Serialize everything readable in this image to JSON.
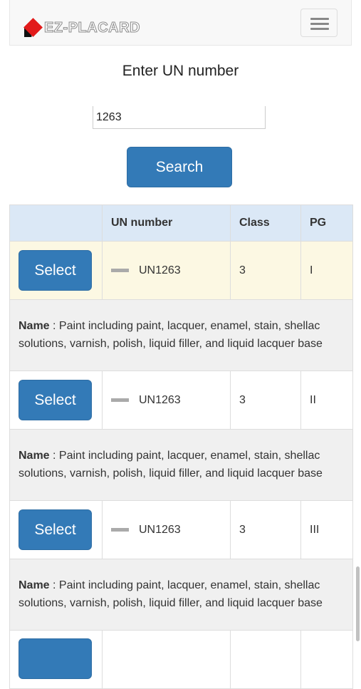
{
  "brand": {
    "text": "EZ-PLACARD"
  },
  "header": {
    "title": "Enter UN number"
  },
  "search": {
    "value": "1263",
    "button_label": "Search"
  },
  "table": {
    "columns": [
      "",
      "UN number",
      "Class",
      "PG"
    ],
    "rows": [
      {
        "select_label": "Select",
        "un": "UN1263",
        "class": "3",
        "pg": "I",
        "name_label": "Name",
        "name": " : Paint including paint, lacquer, enamel, stain, shellac solutions, varnish, polish, liquid filler, and liquid lacquer base"
      },
      {
        "select_label": "Select",
        "un": "UN1263",
        "class": "3",
        "pg": "II",
        "name_label": "Name",
        "name": " : Paint including paint, lacquer, enamel, stain, shellac solutions, varnish, polish, liquid filler, and liquid lacquer base"
      },
      {
        "select_label": "Select",
        "un": "UN1263",
        "class": "3",
        "pg": "III",
        "name_label": "Name",
        "name": " : Paint including paint, lacquer, enamel, stain, shellac solutions, varnish, polish, liquid filler, and liquid lacquer base"
      }
    ]
  },
  "colors": {
    "primary": "#337ab7",
    "header_bg": "#dbe8f6",
    "highlight_row": "#fcf8e3",
    "name_row": "#f0f0f0"
  }
}
